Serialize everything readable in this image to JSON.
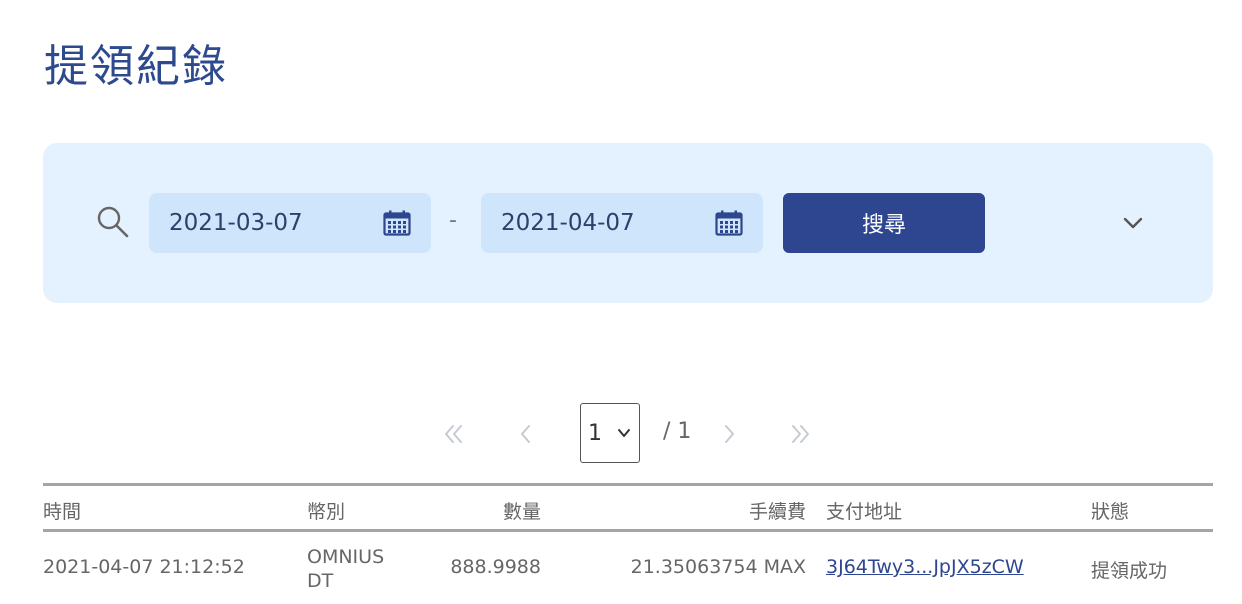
{
  "page": {
    "title": "提領紀錄"
  },
  "filter": {
    "date_from": "2021-03-07",
    "separator": "-",
    "date_to": "2021-04-07",
    "search_label": "搜尋",
    "icons": [
      "search-icon",
      "calendar-icon",
      "chevron-down-icon"
    ]
  },
  "pagination": {
    "current_page": "1",
    "total_label": "/ 1",
    "icons": [
      "double-chevron-left-icon",
      "chevron-left-icon",
      "chevron-right-icon",
      "double-chevron-right-icon"
    ]
  },
  "table": {
    "headers": {
      "time": "時間",
      "currency": "幣別",
      "amount": "數量",
      "fee": "手續費",
      "address": "支付地址",
      "status": "狀態"
    },
    "rows": [
      {
        "time": "2021-04-07 21:12:52",
        "currency": "OMNIUS DT",
        "amount": "888.9988",
        "fee": "21.35063754 MAX",
        "address": "3J64Twy3...JpJX5zCW",
        "status": "提領成功"
      }
    ]
  },
  "colors": {
    "primary": "#2e4690",
    "title": "#2e4a8e",
    "panel_bg": "#e4f1fe",
    "field_bg": "#cfe5fb"
  }
}
